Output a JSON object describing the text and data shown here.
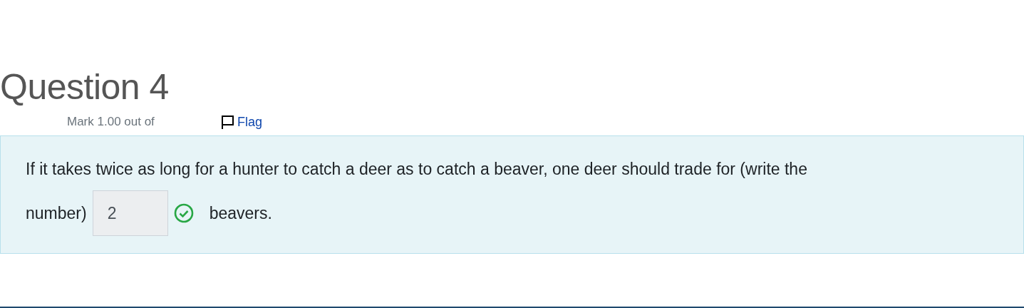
{
  "question": {
    "title": "Question 4",
    "mark": "Mark 1.00 out of",
    "flag": "Flag",
    "flagged": false
  },
  "content": {
    "lines": [
      "If it takes twice as long for a hunter to catch a deer as to catch a beaver, one deer should trade for (write the",
      "number)"
    ],
    "answer": "2",
    "correct": true,
    "text_after": "beavers."
  }
}
